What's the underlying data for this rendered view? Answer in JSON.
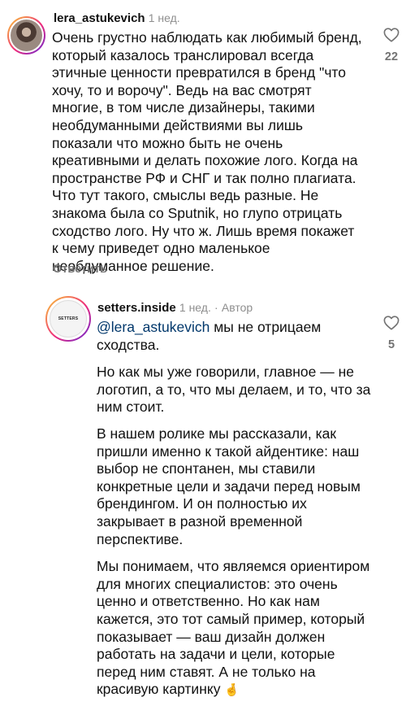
{
  "comments": [
    {
      "username": "lera_astukevich",
      "time": "1 нед.",
      "lines": [
        "Очень грустно наблюдать как любимый бренд,",
        "который казалось транслировал всегда",
        "этичные ценности превратился в бренд \"что",
        "хочу, то и ворочу\". Ведь на вас смотрят",
        "многие, в том числе дизайнеры, такими",
        "необдуманными действиями вы лишь",
        "показали что можно быть не очень",
        "креативными и делать похожие лого. Когда на",
        "пространстве РФ и СНГ и так полно плагиата.",
        "Что тут такого, смыслы ведь разные. Не",
        "знакома была со Sputnik, но глупо отрицать",
        "сходство лого. Ну что ж. Лишь время покажет",
        "к чему приведет одно маленькое",
        "необдуманное решение."
      ],
      "reply_label": "Ответить",
      "like_count": "22"
    },
    {
      "username": "setters.inside",
      "time": "1 нед.",
      "separator": "·",
      "author_badge": "Автор",
      "avatar_text": "SETTERS",
      "mention": "@lera_astukevich",
      "first_line_rest": " мы не отрицаем",
      "paragraphs": [
        [
          "сходства."
        ],
        [
          "Но как мы уже говорили, главное — не",
          "логотип, а то, что мы делаем, и то, что за",
          "ним стоит."
        ],
        [
          "В нашем ролике мы рассказали, как",
          "пришли именно к такой айдентике: наш",
          "выбор не спонтанен, мы ставили",
          "конкретные цели и задачи перед новым",
          "брендингом. И он полностью их",
          "закрывает в разной временной",
          "перспективе."
        ],
        [
          "Мы понимаем, что являемся ориентиром",
          "для многих специалистов: это очень",
          "ценно и ответственно. Но как нам",
          "кажется, это тот самый пример, который",
          "показывает — ваш дизайн должен",
          "работать на задачи и цели, которые",
          "перед ним ставят. А не только на",
          "красивую картинку"
        ]
      ],
      "emoji": "🤞",
      "like_count": "5"
    }
  ],
  "icons": {
    "heart": "heart-outline-icon"
  },
  "colors": {
    "text": "#111111",
    "secondary": "#8e8e8e",
    "mention": "#00376b"
  }
}
